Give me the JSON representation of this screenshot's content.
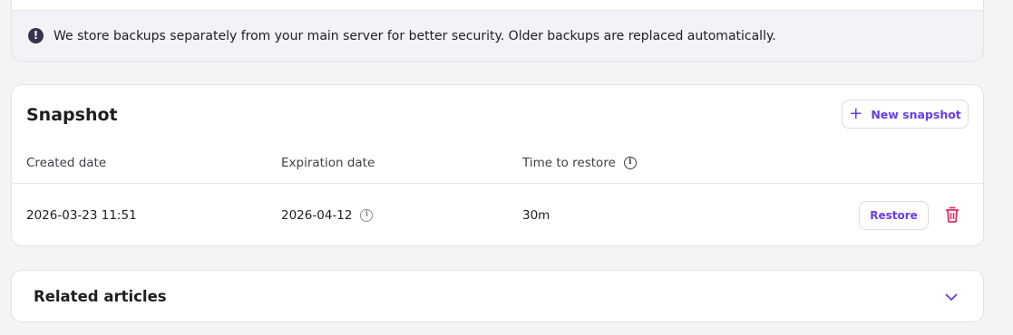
{
  "notice": {
    "icon": "exclamation-icon",
    "text": "We store backups separately from your main server for better security. Older backups are replaced automatically."
  },
  "snapshot": {
    "title": "Snapshot",
    "new_button": {
      "icon": "plus-icon",
      "label": "New snapshot"
    },
    "columns": {
      "created": "Created date",
      "expiration": "Expiration date",
      "restore_time": "Time to restore"
    },
    "rows": [
      {
        "created": "2026-03-23 11:51",
        "expiration": "2026-04-12",
        "restore_time": "30m",
        "restore_label": "Restore",
        "delete_icon": "trash-icon"
      }
    ]
  },
  "related": {
    "title": "Related articles",
    "icon": "chevron-down-icon"
  },
  "colors": {
    "accent": "#673de6",
    "danger": "#d63163",
    "background": "#f4f4f4"
  }
}
